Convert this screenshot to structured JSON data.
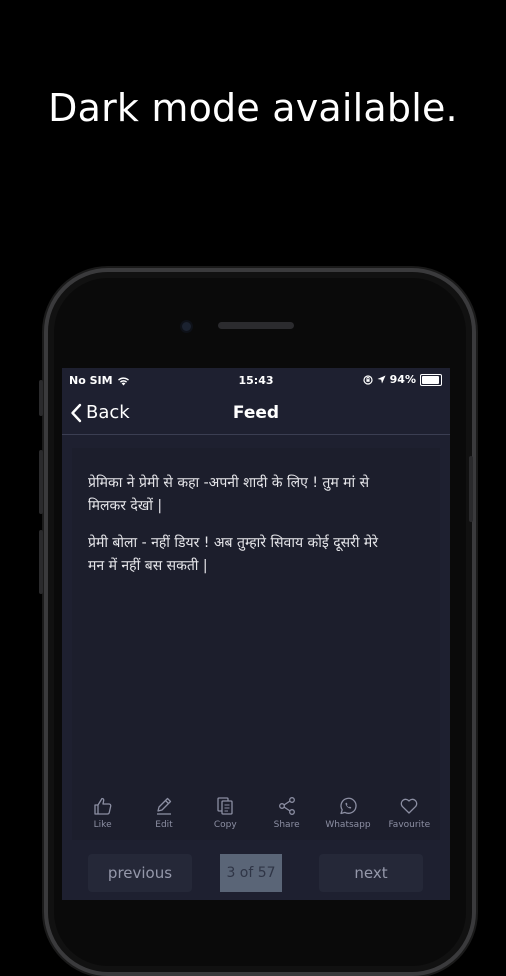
{
  "headline": "Dark mode available.",
  "status": {
    "carrier": "No SIM",
    "time": "15:43",
    "battery": "94%",
    "battery_level": 0.94
  },
  "nav": {
    "back_label": "Back",
    "title": "Feed"
  },
  "post": {
    "paragraphs": [
      "प्रेमिका ने प्रेमी से कहा -अपनी शादी के लिए ! तुम मां से मिलकर देखों |",
      "प्रेमी बोला - नहीं डियर ! अब तुम्हारे सिवाय कोई दूसरी मेरे मन में नहीं बस सकती |"
    ]
  },
  "actions": {
    "like": "Like",
    "edit": "Edit",
    "copy": "Copy",
    "share": "Share",
    "whatsapp": "Whatsapp",
    "favourite": "Favourite"
  },
  "pager": {
    "previous": "previous",
    "counter": "3 of 57",
    "next": "next"
  },
  "colors": {
    "background": "#000000",
    "screen": "#1e2030",
    "card": "#1c1e2c",
    "icon": "#8c8fa3",
    "counter_bg": "#5a6577"
  }
}
